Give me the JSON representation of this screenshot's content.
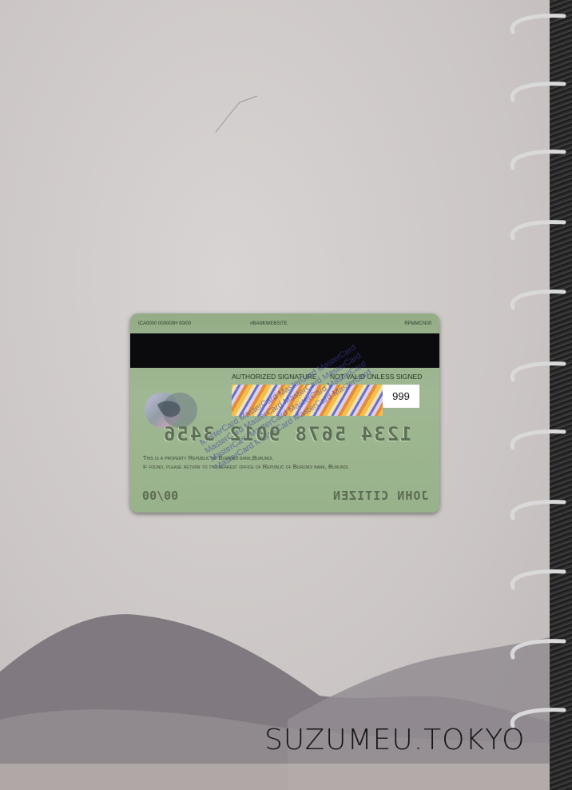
{
  "card": {
    "top_left": "ICA0000 000000H 00/00",
    "top_center": "#BANKWEBSITE",
    "top_right": "RPMMCN00",
    "signature_label": "AUTHORIZED SIGNATURE",
    "validity_label": "NOT VALID UNLESS SIGNED",
    "panel_pattern_text": "MasterCard MasterCard MasterCard MasterCard MasterCard MasterCard MasterCard MasterCard MasterCard MasterCard MasterCard MasterCard MasterCard MasterCard MasterCard MasterCard",
    "cvv": "999",
    "number": "1234 5678 9012 3456",
    "legal_line1": "This is a property Republic of Burundi bank,Burundi.",
    "legal_line2": "If found, please return to the nearest office of Republic of Burundi bank, Burundi.",
    "expiry": "00/00",
    "holder": "JOHN CITIZEN",
    "colors": {
      "card": "#9fb893",
      "stripe": "#0b0b0d"
    }
  },
  "watermark": "SUZUMEU.TOKYO"
}
